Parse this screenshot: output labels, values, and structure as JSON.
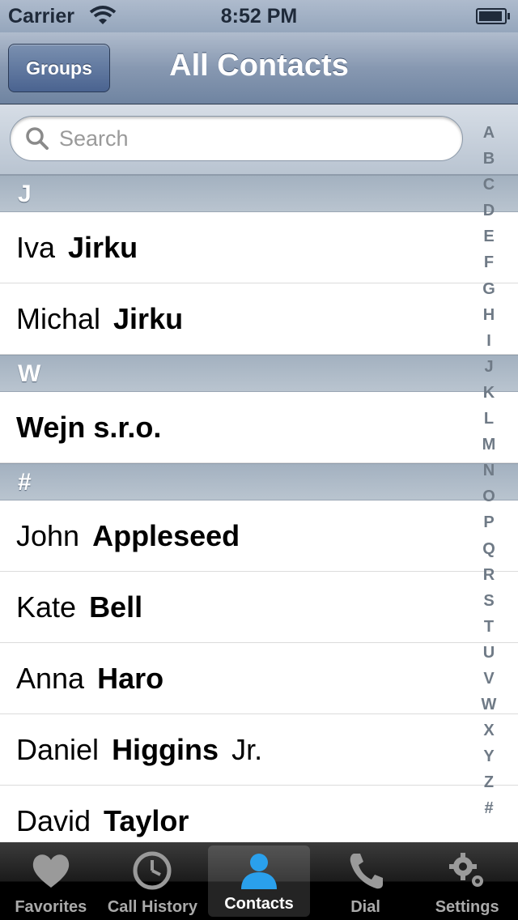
{
  "status_bar": {
    "carrier": "Carrier",
    "time": "8:52 PM"
  },
  "nav": {
    "groups_label": "Groups",
    "title": "All Contacts"
  },
  "search": {
    "placeholder": "Search",
    "value": ""
  },
  "sections": [
    {
      "letter": "J",
      "rows": [
        {
          "first": "Iva",
          "last": "Jirku"
        },
        {
          "first": "Michal",
          "last": "Jirku"
        }
      ]
    },
    {
      "letter": "W",
      "rows": [
        {
          "company": "Wejn s.r.o."
        }
      ]
    },
    {
      "letter": "#",
      "rows": [
        {
          "first": "John",
          "last": "Appleseed"
        },
        {
          "first": "Kate",
          "last": "Bell"
        },
        {
          "first": "Anna",
          "last": "Haro"
        },
        {
          "first": "Daniel",
          "last": "Higgins",
          "suffix": "Jr."
        },
        {
          "first": "David",
          "last": "Taylor"
        }
      ]
    }
  ],
  "index_letters": [
    "A",
    "B",
    "C",
    "D",
    "E",
    "F",
    "G",
    "H",
    "I",
    "J",
    "K",
    "L",
    "M",
    "N",
    "O",
    "P",
    "Q",
    "R",
    "S",
    "T",
    "U",
    "V",
    "W",
    "X",
    "Y",
    "Z",
    "#"
  ],
  "tabs": [
    {
      "label": "Favorites",
      "icon": "heart-icon",
      "active": false
    },
    {
      "label": "Call History",
      "icon": "clock-icon",
      "active": false
    },
    {
      "label": "Contacts",
      "icon": "person-icon",
      "active": true
    },
    {
      "label": "Dial",
      "icon": "phone-icon",
      "active": false
    },
    {
      "label": "Settings",
      "icon": "gears-icon",
      "active": false
    }
  ],
  "colors": {
    "nav_accent": "#6f84a1",
    "active_tab_icon": "#2aa0ec"
  }
}
